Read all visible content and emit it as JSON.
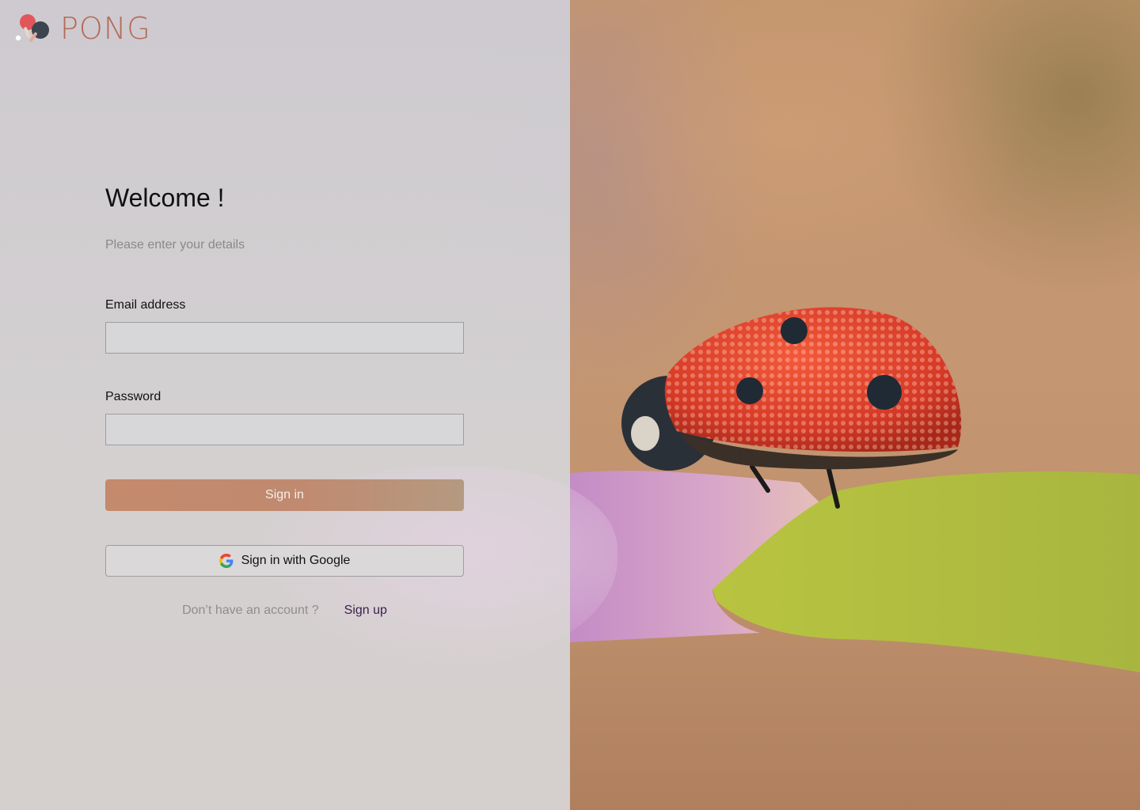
{
  "app": {
    "name": "PONG",
    "brand_color": "#b56b56",
    "accent_color": "#c48a6c"
  },
  "form": {
    "title": "Welcome !",
    "subtitle": "Please enter your details",
    "email": {
      "label": "Email address",
      "value": "",
      "placeholder": ""
    },
    "password": {
      "label": "Password",
      "value": "",
      "placeholder": ""
    },
    "sign_in_label": "Sign in",
    "google_label": "Sign in with Google",
    "signup_prompt": "Don’t have an account ?",
    "signup_link": "Sign up"
  },
  "icons": {
    "logo": "ping-pong-paddles-icon",
    "google": "google-g-icon"
  }
}
